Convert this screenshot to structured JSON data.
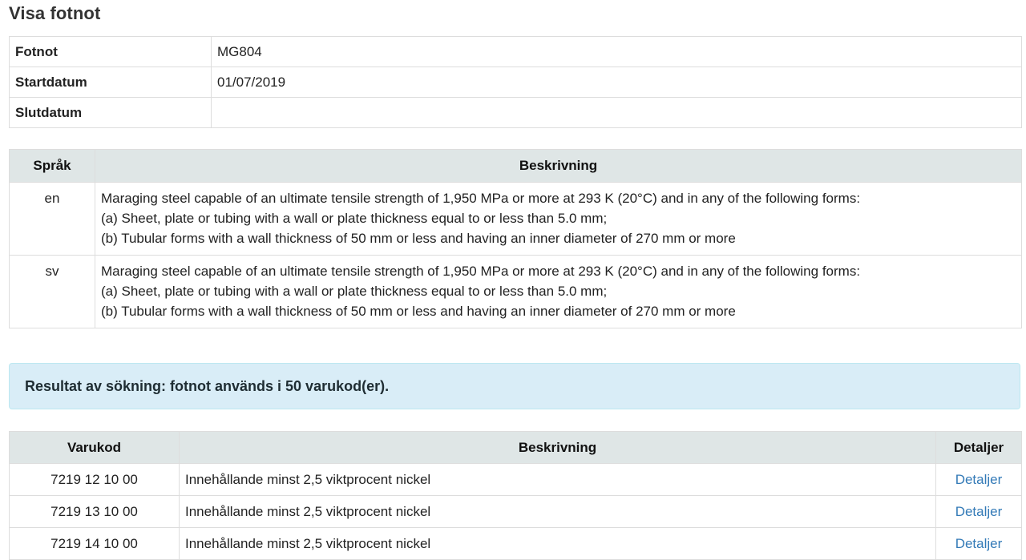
{
  "page_title": "Visa fotnot",
  "footnote_info": {
    "rows": [
      {
        "label": "Fotnot",
        "value": "MG804"
      },
      {
        "label": "Startdatum",
        "value": "01/07/2019"
      },
      {
        "label": "Slutdatum",
        "value": ""
      }
    ]
  },
  "language_table": {
    "headers": {
      "language": "Språk",
      "description": "Beskrivning"
    },
    "rows": [
      {
        "language": "en",
        "lines": [
          "Maraging steel capable of an ultimate tensile strength of 1,950 MPa or more at 293 K (20°C) and in any of the following forms:",
          "(a) Sheet, plate or tubing with a wall or plate thickness equal to or less than 5.0 mm;",
          "(b) Tubular forms with a wall thickness of 50 mm or less and having an inner diameter of 270 mm or more"
        ]
      },
      {
        "language": "sv",
        "lines": [
          "Maraging steel capable of an ultimate tensile strength of 1,950 MPa or more at 293 K (20°C) and in any of the following forms:",
          "(a) Sheet, plate or tubing with a wall or plate thickness equal to or less than 5.0 mm;",
          "(b) Tubular forms with a wall thickness of 50 mm or less and having an inner diameter of 270 mm or more"
        ]
      }
    ]
  },
  "result_alert": "Resultat av sökning: fotnot används i 50 varukod(er).",
  "results_table": {
    "headers": {
      "code": "Varukod",
      "description": "Beskrivning",
      "details": "Detaljer"
    },
    "rows": [
      {
        "code": "7219 12 10 00",
        "description": "Innehållande minst 2,5 viktprocent nickel",
        "details": "Detaljer"
      },
      {
        "code": "7219 13 10 00",
        "description": "Innehållande minst 2,5 viktprocent nickel",
        "details": "Detaljer"
      },
      {
        "code": "7219 14 10 00",
        "description": "Innehållande minst 2,5 viktprocent nickel",
        "details": "Detaljer"
      }
    ]
  },
  "colors": {
    "header_bg": "#dfe6e6",
    "alert_bg": "#d9edf7",
    "alert_border": "#bce8f1",
    "link": "#337ab7",
    "border": "#dddddd"
  }
}
